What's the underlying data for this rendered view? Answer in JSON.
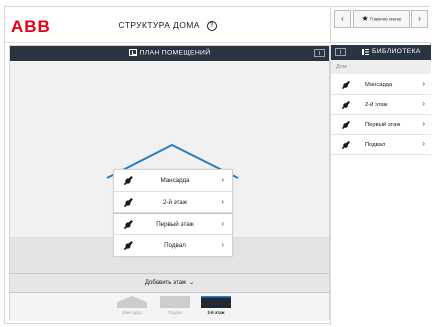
{
  "brand": {
    "logo": "ABB",
    "logo_color": "#e2001a"
  },
  "header": {
    "title": "СТРУКТУРА ДОМА",
    "help_glyph": "?"
  },
  "nav": {
    "prev": "‹",
    "next": "›",
    "main_label": "Главное меню",
    "main_icon": "star-icon"
  },
  "floor_plan": {
    "title": "ПЛАН ПОМЕЩЕНИЙ",
    "floors": [
      {
        "label": "Мансарда",
        "chevron": "›"
      },
      {
        "label": "2-й этаж",
        "chevron": "›"
      },
      {
        "label": "Первый этаж",
        "chevron": "›"
      },
      {
        "label": "Подвал",
        "chevron": "›"
      }
    ],
    "add_floor": "Добавить этаж",
    "add_floor_chevron": "⌄",
    "thumbnails": [
      {
        "label": "Мансарда",
        "active": false
      },
      {
        "label": "Подвал",
        "active": false
      },
      {
        "label": "2-й этаж",
        "active": true
      }
    ]
  },
  "library": {
    "title": "БИБЛИОТЕКА",
    "breadcrumb": "Дом",
    "items": [
      {
        "label": "Мансарда",
        "chevron": "›"
      },
      {
        "label": "2-й этаж",
        "chevron": "›"
      },
      {
        "label": "Первый этаж",
        "chevron": "›"
      },
      {
        "label": "Подвал",
        "chevron": "›"
      }
    ]
  },
  "colors": {
    "dark_header": "#2a3440",
    "roof": "#2a7dc4",
    "thumb_inactive": "#cdcdcd",
    "thumb_active": "#1f2833"
  }
}
